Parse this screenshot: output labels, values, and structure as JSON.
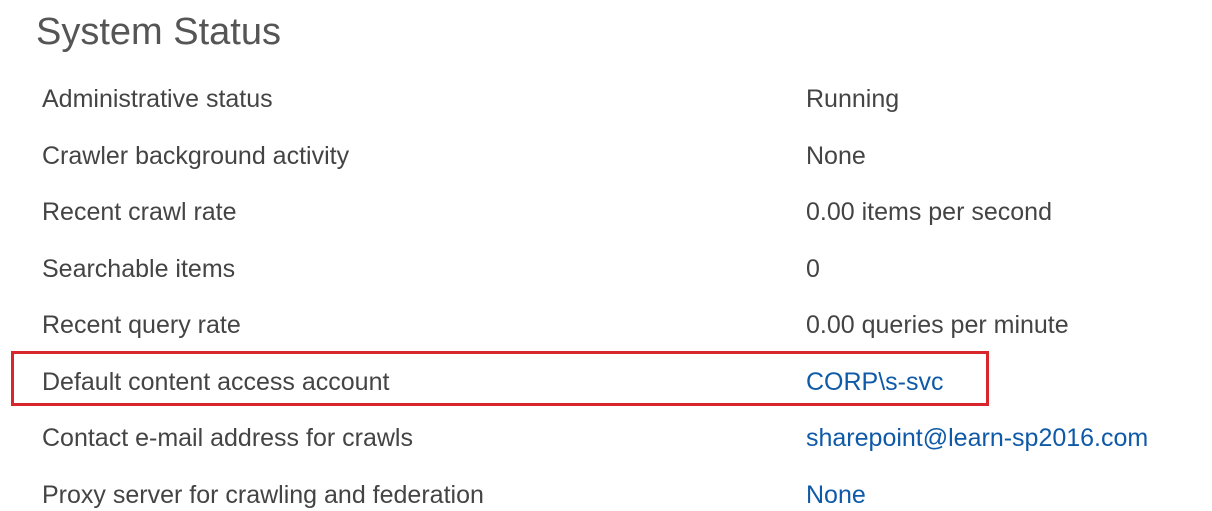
{
  "page": {
    "title": "System Status"
  },
  "rows": [
    {
      "label": "Administrative status",
      "value": "Running"
    },
    {
      "label": "Crawler background activity",
      "value": "None"
    },
    {
      "label": "Recent crawl rate",
      "value": "0.00 items per second"
    },
    {
      "label": "Searchable items",
      "value": "0"
    },
    {
      "label": "Recent query rate",
      "value": "0.00 queries per minute"
    },
    {
      "label": "Default content access account",
      "value": "CORP\\s-svc"
    },
    {
      "label": "Contact e-mail address for crawls",
      "value": "sharepoint@learn-sp2016.com"
    },
    {
      "label": "Proxy server for crawling and federation",
      "value": "None"
    }
  ],
  "colors": {
    "link": "#0f5aa8",
    "highlight_border": "#d8272c",
    "text": "#444444"
  }
}
